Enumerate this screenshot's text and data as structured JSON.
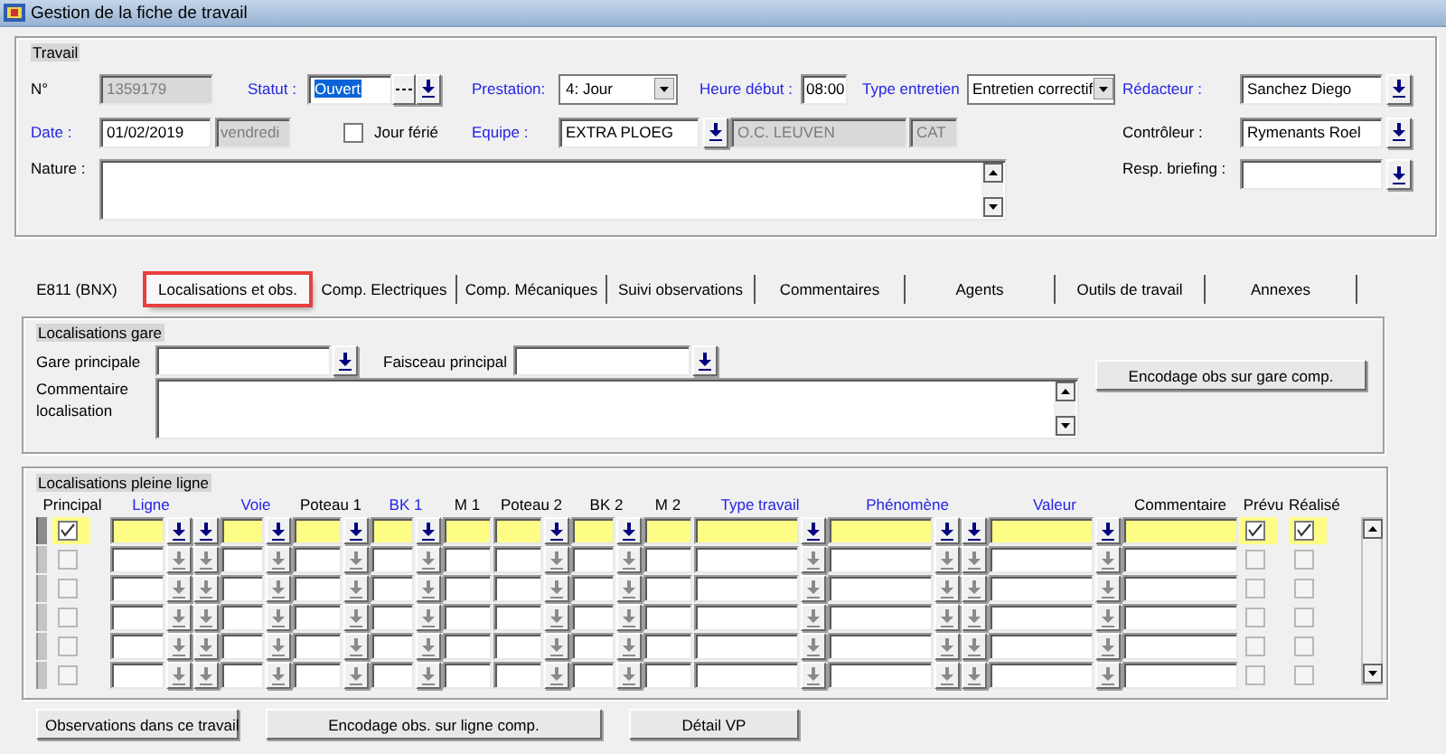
{
  "window": {
    "title": "Gestion de la fiche de travail"
  },
  "travail": {
    "title": "Travail",
    "numero": {
      "label": "N°",
      "required": false,
      "value": "1359179"
    },
    "statut": {
      "label": "Statut :",
      "required": true,
      "value": "Ouvert",
      "value_highlighted": true
    },
    "prestation": {
      "label": "Prestation:",
      "required": true,
      "value": "4: Jour"
    },
    "heure_debut": {
      "label": "Heure début :",
      "required": true,
      "value": "08:00"
    },
    "type_entretien": {
      "label": "Type entretien",
      "required": true,
      "value": "Entretien correctif"
    },
    "redacteur": {
      "label": "Rédacteur :",
      "required": true,
      "value": "Sanchez Diego"
    },
    "date": {
      "label": "Date :",
      "required": true,
      "value": "01/02/2019",
      "day": "vendredi"
    },
    "jour_ferie": {
      "label": "Jour férié",
      "checked": false
    },
    "equipe": {
      "label": "Equipe :",
      "required": true,
      "value": "EXTRA PLOEG",
      "district": "O.C. LEUVEN",
      "category": "CAT"
    },
    "controleur": {
      "label": "Contrôleur :",
      "required": false,
      "value": "Rymenants Roel"
    },
    "nature": {
      "label": "Nature :",
      "required": false
    },
    "resp_briefing": {
      "label": "Resp. briefing :",
      "required": false
    }
  },
  "tabs": [
    {
      "label": "E811 (BNX)",
      "selected": false,
      "highlighted": false
    },
    {
      "label": "Localisations et obs.",
      "selected": true,
      "highlighted": true
    },
    {
      "label": "Comp. Electriques",
      "selected": false,
      "highlighted": false
    },
    {
      "label": "Comp. Mécaniques",
      "selected": false,
      "highlighted": false
    },
    {
      "label": "Suivi observations",
      "selected": false,
      "highlighted": false
    },
    {
      "label": "Commentaires",
      "selected": false,
      "highlighted": false
    },
    {
      "label": "Agents",
      "selected": false,
      "highlighted": false
    },
    {
      "label": "Outils de travail",
      "selected": false,
      "highlighted": false
    },
    {
      "label": "Annexes",
      "selected": false,
      "highlighted": false
    }
  ],
  "localisations_gare": {
    "title": "Localisations gare",
    "gare_principale": "Gare principale",
    "faisceau_principal": "Faisceau principal",
    "commentaire": "Commentaire localisation",
    "button": "Encodage obs sur gare comp."
  },
  "localisations_ligne": {
    "title": "Localisations pleine ligne",
    "columns": [
      {
        "label": "Principal",
        "required": false
      },
      {
        "label": "Ligne",
        "required": true
      },
      {
        "label": "Voie",
        "required": true
      },
      {
        "label": "Poteau 1",
        "required": false
      },
      {
        "label": "BK 1",
        "required": true
      },
      {
        "label": "M 1",
        "required": false
      },
      {
        "label": "Poteau 2",
        "required": false
      },
      {
        "label": "BK 2",
        "required": false
      },
      {
        "label": "M 2",
        "required": false
      },
      {
        "label": "Type travail",
        "required": true
      },
      {
        "label": "Phénomène",
        "required": true
      },
      {
        "label": "Valeur",
        "required": true
      },
      {
        "label": "Commentaire",
        "required": false
      },
      {
        "label": "Prévu",
        "required": false
      },
      {
        "label": "Réalisé",
        "required": false
      }
    ],
    "rows": [
      {
        "selected": true,
        "principal": true,
        "prevu": true,
        "realise": true
      },
      {
        "selected": false,
        "principal": false,
        "prevu": false,
        "realise": false
      },
      {
        "selected": false,
        "principal": false,
        "prevu": false,
        "realise": false
      },
      {
        "selected": false,
        "principal": false,
        "prevu": false,
        "realise": false
      },
      {
        "selected": false,
        "principal": false,
        "prevu": false,
        "realise": false
      },
      {
        "selected": false,
        "principal": false,
        "prevu": false,
        "realise": false
      }
    ]
  },
  "buttons": [
    "Observations dans ce travail",
    "Encodage obs. sur ligne comp.",
    "Détail VP"
  ]
}
